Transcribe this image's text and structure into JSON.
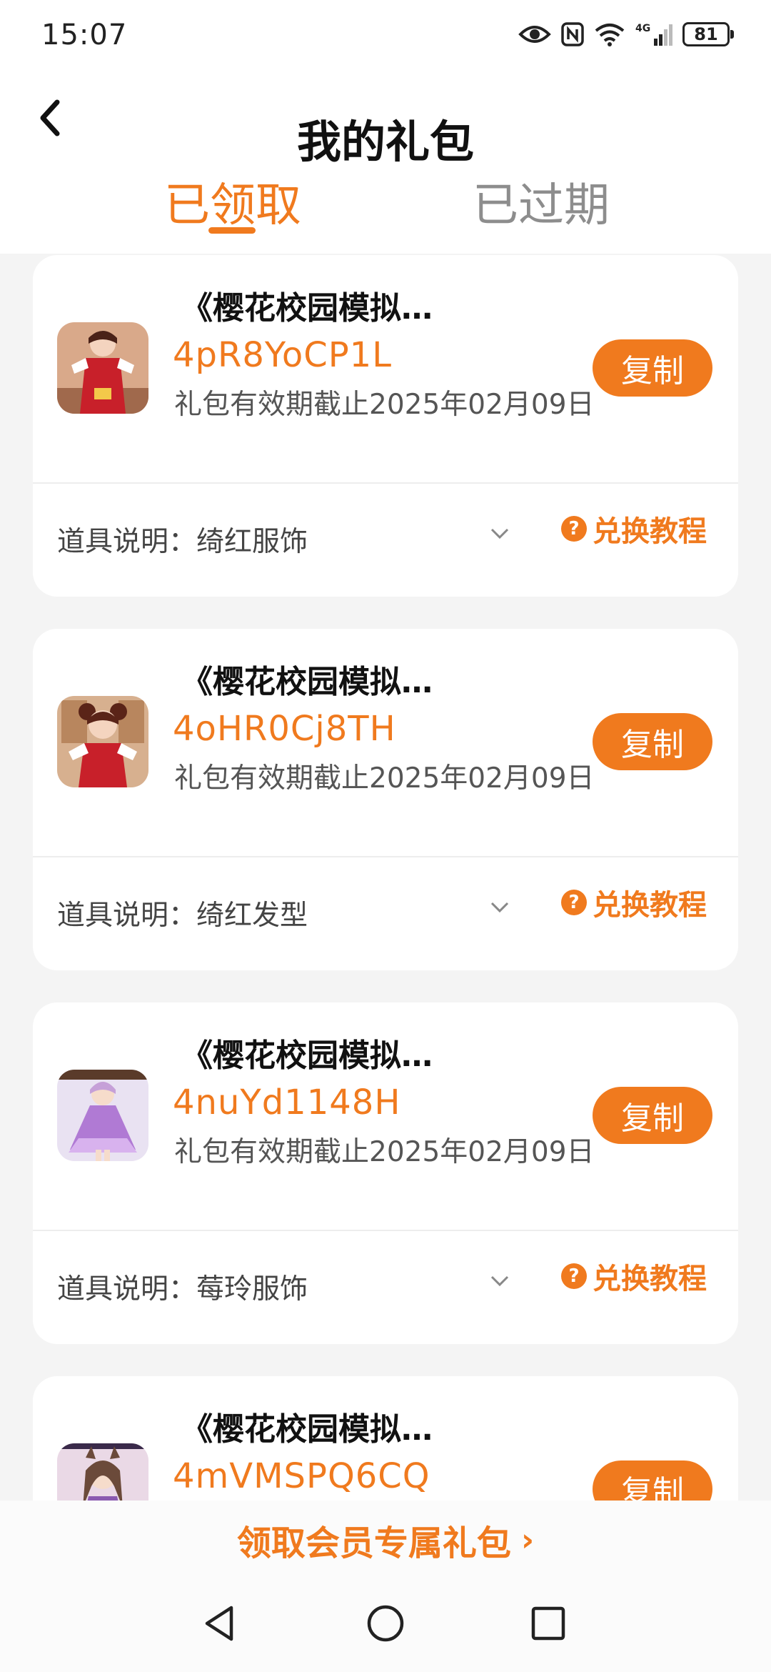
{
  "status_bar": {
    "time": "15:07",
    "battery": "81",
    "network": "4G",
    "icons": [
      "eye-icon",
      "nfc-icon",
      "wifi-icon",
      "signal-icon",
      "battery-icon"
    ]
  },
  "header": {
    "title": "我的礼包",
    "back_icon": "chevron-left-icon"
  },
  "tabs": [
    {
      "label": "已领取",
      "active": true
    },
    {
      "label": "已过期",
      "active": false
    }
  ],
  "colors": {
    "accent": "#f07a1e",
    "background": "#f4f4f4",
    "card": "#ffffff",
    "inactive_tab": "#8d8d8d"
  },
  "cards": [
    {
      "game_name": "《樱花校园模拟…",
      "code": "4pR8YoCP1L",
      "validity": "礼包有效期截止2025年02月09日",
      "copy_label": "复制",
      "item_desc": "道具说明：绮红服饰",
      "tutorial_label": "兑换教程",
      "icon": "game-avatar-icon"
    },
    {
      "game_name": "《樱花校园模拟…",
      "code": "4oHR0Cj8TH",
      "validity": "礼包有效期截止2025年02月09日",
      "copy_label": "复制",
      "item_desc": "道具说明：绮红发型",
      "tutorial_label": "兑换教程",
      "icon": "game-avatar-icon"
    },
    {
      "game_name": "《樱花校园模拟…",
      "code": "4nuYd1148H",
      "validity": "礼包有效期截止2025年02月09日",
      "copy_label": "复制",
      "item_desc": "道具说明：莓玲服饰",
      "tutorial_label": "兑换教程",
      "icon": "game-avatar-icon"
    },
    {
      "game_name": "《樱花校园模拟…",
      "code": "4mVMSPQ6CQ",
      "validity": "",
      "copy_label": "复制",
      "item_desc": "",
      "tutorial_label": "",
      "icon": "game-avatar-icon"
    }
  ],
  "member_banner": {
    "label": "领取会员专属礼包",
    "arrow": "›"
  },
  "nav_bar": {
    "icons": [
      "nav-back-icon",
      "nav-home-icon",
      "nav-recent-icon"
    ]
  }
}
